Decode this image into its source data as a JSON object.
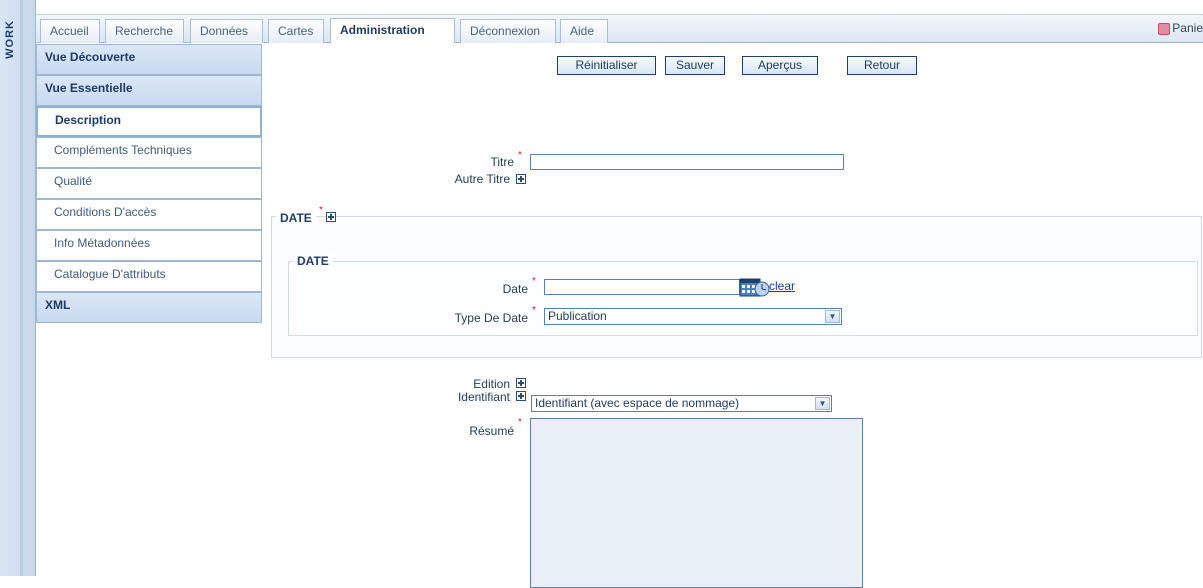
{
  "vstrip": {
    "text": "WORK"
  },
  "tabs": [
    {
      "label": "Accueil",
      "active": false
    },
    {
      "label": "Recherche",
      "active": false
    },
    {
      "label": "Données",
      "active": false
    },
    {
      "label": "Cartes",
      "active": false
    },
    {
      "label": "Administration",
      "active": true
    },
    {
      "label": "Déconnexion",
      "active": false
    },
    {
      "label": "Aide",
      "active": false
    }
  ],
  "panier": "Panie",
  "menu": [
    {
      "label": "Vue Découverte",
      "kind": "major"
    },
    {
      "label": "Vue Essentielle",
      "kind": "major"
    },
    {
      "label": "Description",
      "kind": "selected"
    },
    {
      "label": "Compléments Techniques",
      "kind": "sub"
    },
    {
      "label": "Qualité",
      "kind": "sub"
    },
    {
      "label": "Conditions D'accès",
      "kind": "sub"
    },
    {
      "label": "Info Métadonnées",
      "kind": "sub"
    },
    {
      "label": "Catalogue D'attributs",
      "kind": "sub"
    },
    {
      "label": "XML",
      "kind": "major"
    }
  ],
  "actions": {
    "reset": "Réinitialiser",
    "save": "Sauver",
    "preview": "Aperçus",
    "back": "Retour"
  },
  "form": {
    "titre_label": "Titre",
    "titre_value": "",
    "autre_titre_label": "Autre Titre",
    "date_section_legend": "DATE",
    "date_inner_legend": "DATE",
    "date_label": "Date",
    "date_value": "",
    "clear_label": "clear",
    "type_date_label": "Type De Date",
    "type_date_value": "Publication",
    "edition_label": "Edition",
    "identifiant_label": "Identifiant",
    "identifiant_value": "Identifiant (avec espace de nommage)",
    "resume_label": "Résumé",
    "resume_value": ""
  },
  "colors": {
    "accent": "#1e3f6e",
    "required": "#d0202a",
    "link": "#1a3ea8"
  }
}
